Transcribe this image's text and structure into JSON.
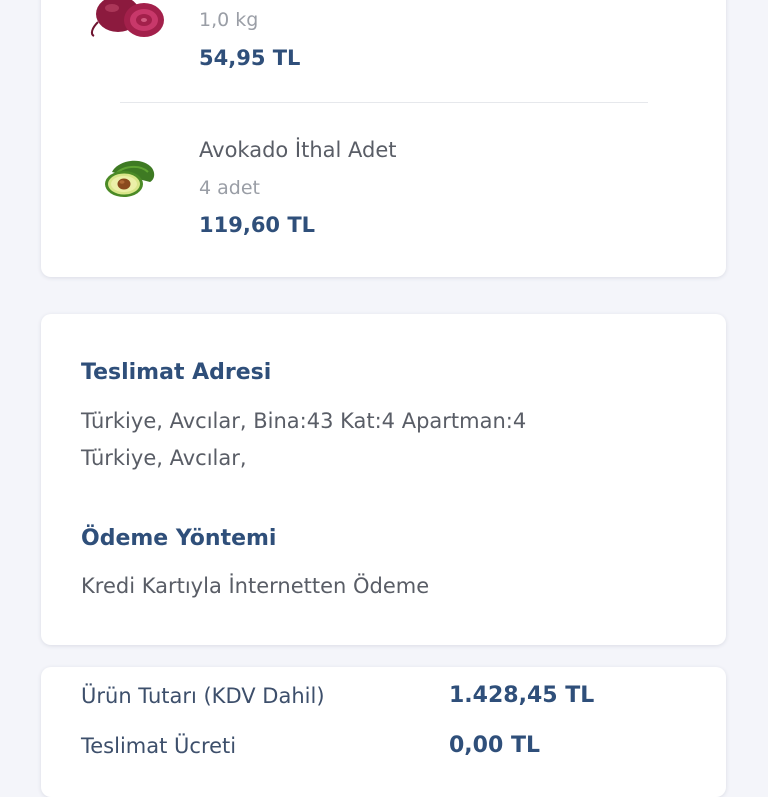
{
  "items": [
    {
      "name": "",
      "quantity": "1,0 kg",
      "price": "54,95 TL",
      "image": "beet-image"
    },
    {
      "name": "Avokado İthal Adet",
      "quantity": "4 adet",
      "price": "119,60 TL",
      "image": "avocado-image"
    }
  ],
  "delivery": {
    "title": "Teslimat Adresi",
    "line1": "Türkiye, Avcılar,  Bina:43 Kat:4 Apartman:4",
    "line2": "Türkiye, Avcılar,"
  },
  "payment": {
    "title": "Ödeme Yöntemi",
    "method": "Kredi Kartıyla İnternetten Ödeme"
  },
  "summary": {
    "rows": [
      {
        "label": "Ürün Tutarı (KDV Dahil)",
        "value": "1.428,45 TL"
      },
      {
        "label": "Teslimat Ücreti",
        "value": "0,00 TL"
      }
    ]
  },
  "colors": {
    "accent": "#2f4f7a",
    "background": "#f4f5fa"
  }
}
